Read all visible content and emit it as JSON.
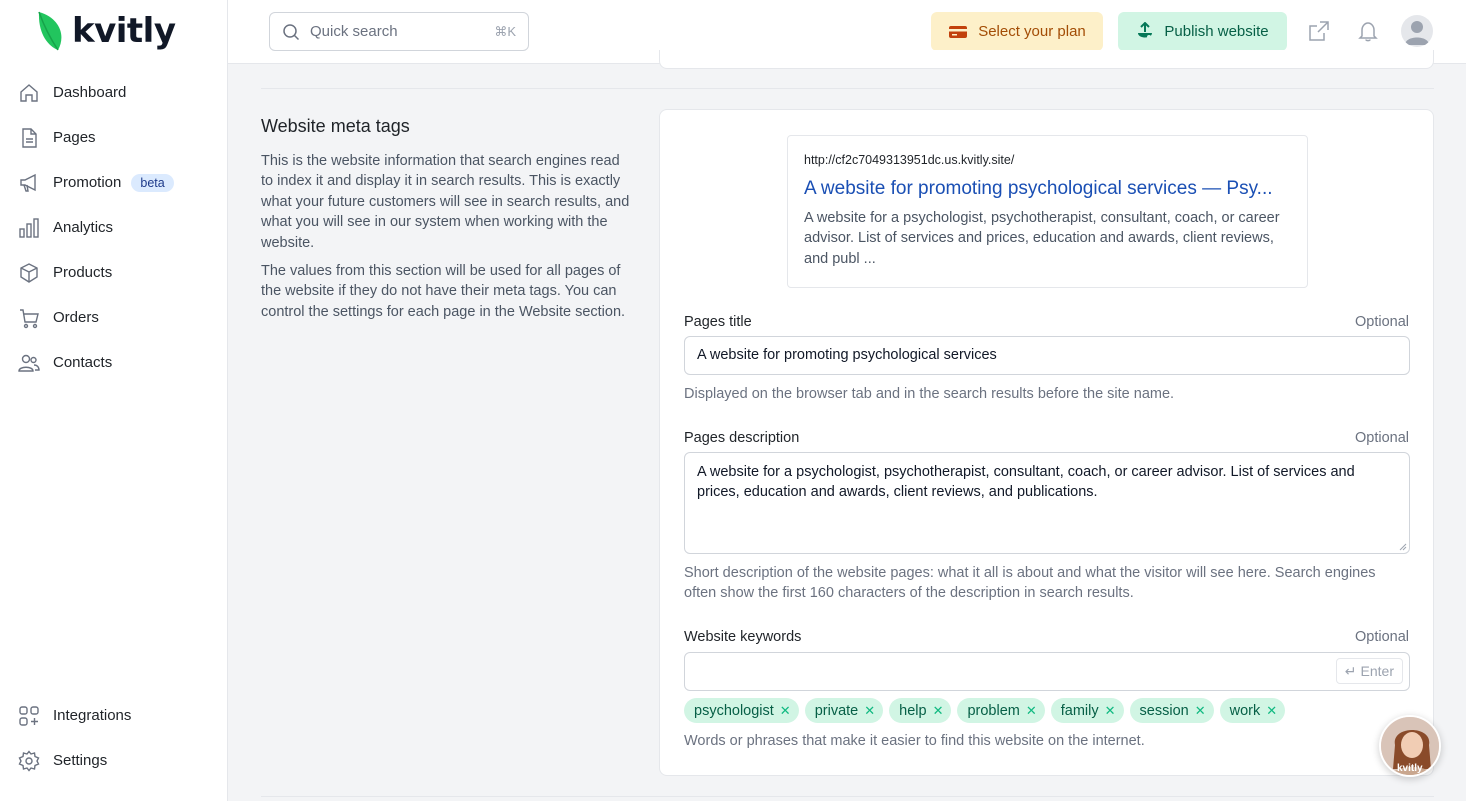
{
  "brand": {
    "name": "kvitly",
    "leaf_color": "#22c55e"
  },
  "sidebar": {
    "items": [
      {
        "label": "Dashboard",
        "icon": "home-icon"
      },
      {
        "label": "Pages",
        "icon": "file-icon"
      },
      {
        "label": "Promotion",
        "icon": "megaphone-icon",
        "badge": "beta"
      },
      {
        "label": "Analytics",
        "icon": "bar-chart-icon"
      },
      {
        "label": "Products",
        "icon": "box-icon"
      },
      {
        "label": "Orders",
        "icon": "cart-icon"
      },
      {
        "label": "Contacts",
        "icon": "users-icon"
      }
    ],
    "bottom_items": [
      {
        "label": "Integrations",
        "icon": "grid-plus-icon"
      },
      {
        "label": "Settings",
        "icon": "gear-icon"
      }
    ]
  },
  "header": {
    "search_placeholder": "Quick search",
    "search_shortcut": "⌘K",
    "plan_button": "Select your plan",
    "publish_button": "Publish website"
  },
  "section": {
    "title": "Website meta tags",
    "desc1": "This is the website information that search engines read to index it and display it in search results. This is exactly what your future customers will see in search results, and what you will see in our system when working with the website.",
    "desc2": "The values from this section will be used for all pages of the website if they do not have their meta tags. You can control the settings for each page in the Website section."
  },
  "preview": {
    "url": "http://cf2c7049313951dc.us.kvitly.site/",
    "title": "A website for promoting psychological services — Psy...",
    "desc": "A website for a psychologist, psychotherapist, consultant, coach, or career advisor. List of services and prices, education and awards, client reviews, and publ ..."
  },
  "fields": {
    "title_label": "Pages title",
    "title_optional": "Optional",
    "title_value": "A website for promoting psychological services",
    "title_help": "Displayed on the browser tab and in the search results before the site name.",
    "desc_label": "Pages description",
    "desc_optional": "Optional",
    "desc_value": "A website for a psychologist, psychotherapist, consultant, coach, or career advisor. List of services and prices, education and awards, client reviews, and publications.",
    "desc_help": "Short description of the website pages: what it all is about and what the visitor will see here. Search engines often show the first 160 characters of the description in search results.",
    "kw_label": "Website keywords",
    "kw_optional": "Optional",
    "kw_enter": "Enter",
    "kw_help": "Words or phrases that make it easier to find this website on the internet.",
    "keywords": [
      "psychologist",
      "private",
      "help",
      "problem",
      "family",
      "session",
      "work"
    ]
  },
  "chat_widget": {
    "label": "kvitly"
  }
}
